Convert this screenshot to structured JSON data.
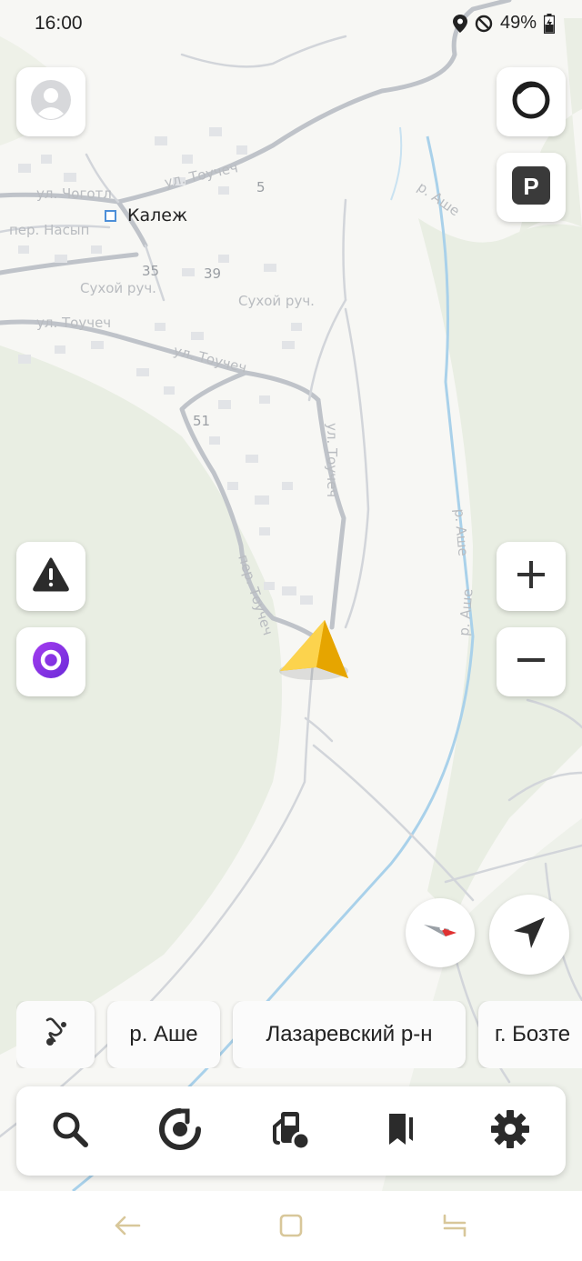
{
  "status": {
    "time": "16:00",
    "battery": "49%"
  },
  "map": {
    "town_label": "Калеж",
    "street_labels": [
      "ул. Тоучеч",
      "ул. Тоучеч",
      "пер. Тоучеч",
      "ул. Тоучеч",
      "пер. Насып",
      "ул. Чоготл"
    ],
    "river_labels": [
      "р. Аше",
      "р. Аше",
      "р. Аше"
    ],
    "stream_labels": [
      "Сухой руч.",
      "Сухой руч."
    ],
    "house_numbers": [
      "35",
      "39",
      "51",
      "5"
    ]
  },
  "buttons": {
    "profile": "profile",
    "alice_top": "alice-ring",
    "parking": "P",
    "report": "report",
    "alice": "alice",
    "zoom_in": "+",
    "zoom_out": "−",
    "compass": "compass",
    "locate": "locate"
  },
  "chips": [
    "р. Аше",
    "Лазаревский р-н",
    "г. Бозте"
  ],
  "bottom_nav": [
    "search",
    "speed",
    "gas-station",
    "bookmarks",
    "settings"
  ],
  "colors": {
    "accent_yellow": "#f7c32c",
    "alice_purple": "#8a2be2",
    "road": "#bfc3c9",
    "water": "#9fcbe6"
  }
}
